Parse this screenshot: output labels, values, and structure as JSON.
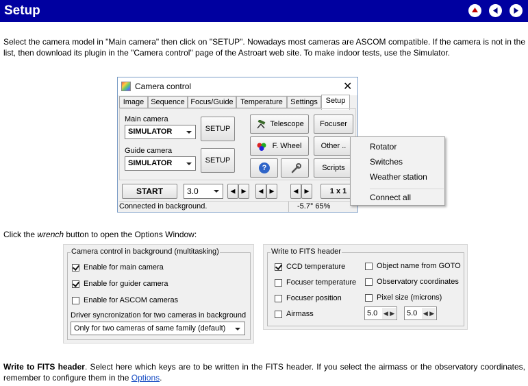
{
  "header": {
    "title": "Setup"
  },
  "intro": {
    "text": "Select the camera model in \"Main camera\" then click on \"SETUP\". Nowadays most cameras are ASCOM compatible. If the camera is not in the list, then download its plugin in the \"Camera control\" page of the Astroart web site. To make indoor tests, use the Simulator."
  },
  "camera_window": {
    "title": "Camera control",
    "close_glyph": "✕",
    "tabs": [
      "Image",
      "Sequence",
      "Focus/Guide",
      "Temperature",
      "Settings",
      "Setup"
    ],
    "main_camera_label": "Main camera",
    "main_camera_value": "SIMULATOR",
    "guide_camera_label": "Guide camera",
    "guide_camera_value": "SIMULATOR",
    "setup_label": "SETUP",
    "telescope_label": "Telescope",
    "focuser_label": "Focuser",
    "fwheel_label": "F. Wheel",
    "other_label": "Other ..",
    "scripts_label": "Scripts",
    "help_glyph": "?",
    "start_label": "START",
    "exposure_value": "3.0",
    "binning_label": "1 x 1",
    "status_text": "Connected in background.",
    "status_temp": "-5.7°  65%"
  },
  "other_menu": {
    "items": [
      "Rotator",
      "Switches",
      "Weather station"
    ],
    "last_item": "Connect all"
  },
  "wrench_text": {
    "before": "Click the ",
    "emph": "wrench",
    "after": " button to open the Options Window:"
  },
  "background_panel": {
    "title": "Camera control in background (multitasking)",
    "enable_main": "Enable for main camera",
    "enable_guider": "Enable for guider camera",
    "enable_ascom": "Enable for ASCOM cameras",
    "driver_sync_label": "Driver syncronization for two cameras in background",
    "driver_sync_value": "Only for two cameras of same family (default)"
  },
  "fits_panel": {
    "title": "Write to FITS header",
    "ccd_temperature": "CCD temperature",
    "focuser_temperature": "Focuser temperature",
    "focuser_position": "Focuser position",
    "airmass": "Airmass",
    "object_name": "Object name from GOTO",
    "observatory_coordinates": "Observatory coordinates",
    "pixel_size": "Pixel size (microns)",
    "pixel_x": "5.0",
    "pixel_y": "5.0"
  },
  "fits_text": {
    "bold": "Write to FITS header",
    "body": ". Select here which keys are to be written in the FITS header. If you select the airmass or the observatory coordinates, remember to configure them in the ",
    "link": "Options",
    "end": "."
  }
}
